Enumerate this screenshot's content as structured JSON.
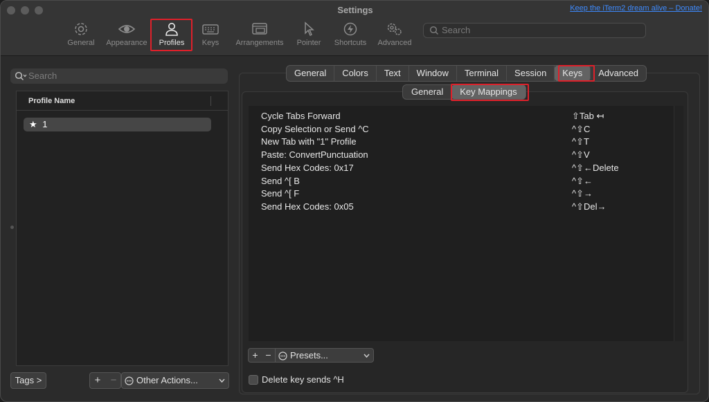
{
  "window": {
    "title": "Settings",
    "donate_link": "Keep the iTerm2 dream alive – Donate!"
  },
  "toolbar": {
    "items": [
      {
        "label": "General",
        "icon": "gear-icon"
      },
      {
        "label": "Appearance",
        "icon": "eye-icon"
      },
      {
        "label": "Profiles",
        "icon": "person-icon",
        "selected": true
      },
      {
        "label": "Keys",
        "icon": "keyboard-icon"
      },
      {
        "label": "Arrangements",
        "icon": "windows-icon"
      },
      {
        "label": "Pointer",
        "icon": "pointer-icon"
      },
      {
        "label": "Shortcuts",
        "icon": "bolt-icon"
      },
      {
        "label": "Advanced",
        "icon": "gears-icon"
      }
    ],
    "search_placeholder": "Search"
  },
  "left": {
    "search_placeholder": "Search",
    "column_header": "Profile Name",
    "profiles": [
      {
        "name": "1",
        "default_star": "★"
      }
    ],
    "tags_label": "Tags >",
    "plus": "+",
    "minus": "−",
    "other_actions_label": "Other Actions..."
  },
  "tabs": [
    "General",
    "Colors",
    "Text",
    "Window",
    "Terminal",
    "Session",
    "Keys",
    "Advanced"
  ],
  "selected_tab": "Keys",
  "subtabs": [
    "General",
    "Key Mappings"
  ],
  "selected_subtab": "Key Mappings",
  "mappings": [
    {
      "action": "Cycle Tabs Forward",
      "key": "⇧Tab ↤"
    },
    {
      "action": "Copy Selection or Send ^C",
      "key": "^⇧C"
    },
    {
      "action": "New Tab with \"1\" Profile",
      "key": "^⇧T"
    },
    {
      "action": "Paste: ConvertPunctuation",
      "key": "^⇧V"
    },
    {
      "action": "Send Hex Codes: 0x17",
      "key": "^⇧←Delete"
    },
    {
      "action": "Send ^[ B",
      "key": "^⇧←"
    },
    {
      "action": "Send ^[ F",
      "key": "^⇧→"
    },
    {
      "action": "Send Hex Codes: 0x05",
      "key": "^⇧Del→"
    }
  ],
  "presets": {
    "plus": "+",
    "minus": "−",
    "label": "Presets..."
  },
  "delete_key_checkbox": {
    "label": "Delete key sends ^H",
    "checked": false
  },
  "colors": {
    "highlight": "#e0202a",
    "link": "#3e8bff"
  }
}
